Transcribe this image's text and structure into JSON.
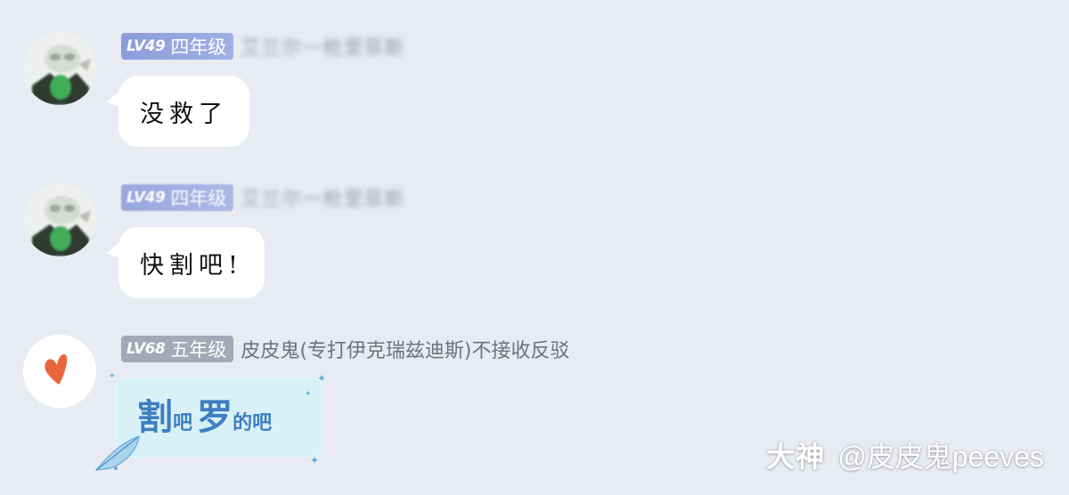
{
  "messages": [
    {
      "badge": {
        "lv": "LV49",
        "grade": "四年级"
      },
      "nickname": "艾兰尔一枪里菲斯",
      "text": "没救了"
    },
    {
      "badge": {
        "lv": "LV49",
        "grade": "四年级"
      },
      "nickname": "艾兰尔一枪里菲斯",
      "text": "快割吧!"
    },
    {
      "badge": {
        "lv": "LV68",
        "grade": "五年级"
      },
      "nickname": "皮皮鬼(专打伊克瑞兹迪斯)不接收反驳",
      "sticker": {
        "w1": "割",
        "w2": "吧",
        "w3": "罗",
        "w4": "的吧"
      }
    }
  ],
  "watermark": {
    "brand": "大神",
    "handle": "@皮皮鬼peeves"
  },
  "colors": {
    "background": "#e9ebf2",
    "bubble": "#ffffff",
    "badge_blue": "#8b9cd9",
    "badge_grey": "#a3a9b6",
    "sticker_bg": "#d8f1f7",
    "sticker_text": "#3e7fc0",
    "heart": "#e8643c"
  },
  "icons": [
    "user-avatar-icon",
    "heart-avatar-icon",
    "feather-icon",
    "sparkle-icon"
  ]
}
